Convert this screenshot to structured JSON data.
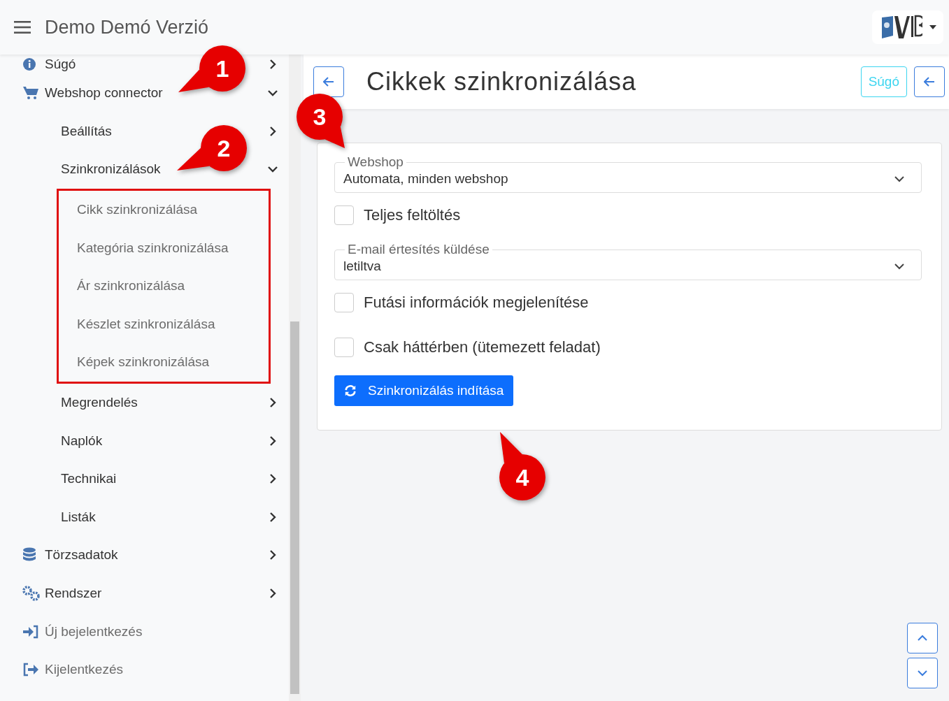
{
  "header": {
    "title": "Demo Demó Verzió"
  },
  "sidebar": {
    "items": [
      {
        "label": "Súgó",
        "kind": "menu",
        "expanded": false
      },
      {
        "label": "Webshop connector",
        "kind": "menu",
        "expanded": true,
        "children": [
          {
            "label": "Beállítás",
            "kind": "menu",
            "expanded": false
          },
          {
            "label": "Szinkronizálások",
            "kind": "menu",
            "expanded": true,
            "highlighted": true,
            "children": [
              {
                "label": "Cikk szinkronizálása",
                "kind": "link"
              },
              {
                "label": "Kategória szinkronizálása",
                "kind": "link"
              },
              {
                "label": "Ár szinkronizálása",
                "kind": "link"
              },
              {
                "label": "Készlet szinkronizálása",
                "kind": "link"
              },
              {
                "label": "Képek szinkronizálása",
                "kind": "link"
              }
            ]
          },
          {
            "label": "Megrendelés",
            "kind": "menu",
            "expanded": false
          },
          {
            "label": "Naplók",
            "kind": "menu",
            "expanded": false
          },
          {
            "label": "Technikai",
            "kind": "menu",
            "expanded": false
          },
          {
            "label": "Listák",
            "kind": "menu",
            "expanded": false
          }
        ]
      },
      {
        "label": "Törzsadatok",
        "kind": "menu",
        "expanded": false
      },
      {
        "label": "Rendszer",
        "kind": "menu",
        "expanded": false
      },
      {
        "label": "Új bejelentkezés",
        "kind": "link"
      },
      {
        "label": "Kijelentkezés",
        "kind": "link"
      }
    ]
  },
  "page": {
    "title": "Cikkek szinkronizálása",
    "help_button": "Súgó"
  },
  "form": {
    "fields": [
      {
        "kind": "select",
        "label": "Webshop",
        "value": "Automata, minden webshop"
      },
      {
        "kind": "checkbox",
        "label": "Teljes feltöltés",
        "checked": false
      },
      {
        "kind": "select",
        "label": "E-mail értesítés küldése",
        "value": "letiltva"
      },
      {
        "kind": "checkbox",
        "label": "Futási információk megjelenítése",
        "checked": false
      },
      {
        "kind": "checkbox",
        "label": "Csak háttérben (ütemezett feladat)",
        "checked": false
      },
      {
        "kind": "button",
        "label": "Szinkronizálás indítása"
      }
    ]
  },
  "callouts": [
    "1",
    "2",
    "3",
    "4"
  ]
}
